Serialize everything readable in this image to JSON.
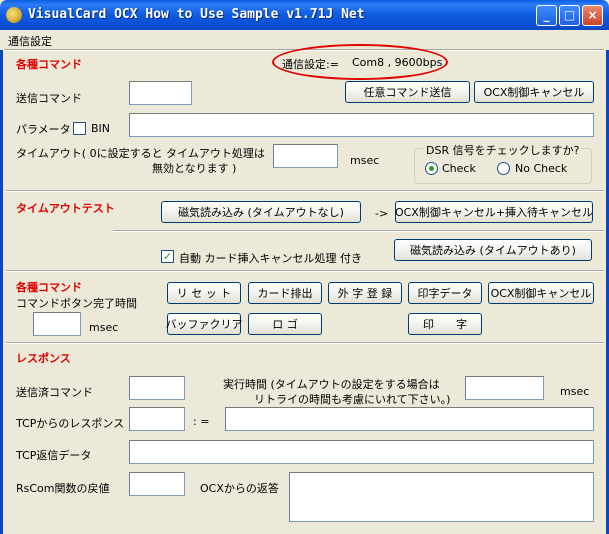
{
  "window": {
    "title": "VisualCard OCX How to Use Sample v1.71J Net",
    "minimize": "_",
    "maximize": "□",
    "close": "×"
  },
  "menu": {
    "item": "通信設定"
  },
  "commands": {
    "section_title": "各種コマンド",
    "comm_setting_label": "通信設定:=",
    "comm_setting_value": "Com8 , 9600bps",
    "send_command_label": "送信コマンド",
    "any_command_button": "任意コマンド送信",
    "ocx_cancel_button": "OCX制御キャンセル",
    "parameter_label": "パラメータ",
    "bin_label": "BIN",
    "timeout_label_1": "タイムアウト( 0に設定すると タイムアウト処理は",
    "timeout_label_2": "無効となります )",
    "msec": "msec",
    "dsr_title": "DSR 信号をチェックしますか?",
    "dsr_check": "Check",
    "dsr_nocheck": "No Check",
    "dsr_selected": "Check"
  },
  "timeout_test": {
    "section_title": "タイムアウトテスト",
    "mag_read_no_timeout": "磁気読み込み (タイムアウトなし)",
    "arrow": "->",
    "ocx_cancel_insert_wait_cancel": "OCX制御キャンセル+挿入待キャンセル",
    "auto_cancel_label": "自動 カード挿入キャンセル処理 付き",
    "auto_cancel_checked": "✓",
    "mag_read_timeout": "磁気読み込み (タイムアウトあり)"
  },
  "various": {
    "section_title": "各種コマンド",
    "button_complete_time": "コマンドボタン完了時間",
    "msec": "msec",
    "reset": "リ セ ッ ト",
    "card_eject": "カード排出",
    "external_char_reg": "外 字 登 録",
    "print_data": "印字データ",
    "ocx_cancel": "OCX制御キャンセル",
    "buffer_clear": "バッファクリア",
    "logo": "ロ ゴ",
    "print": "印　　字"
  },
  "response": {
    "section_title": "レスポンス",
    "sent_command_label": "送信済コマンド",
    "exec_time_label_1": "実行時間 (タイムアウトの設定をする場合は",
    "exec_time_label_2": "リトライの時間も考慮にいれて下さい。)",
    "msec": "msec",
    "tcp_response_label": "TCPからのレスポンス",
    "colon_eq": ": =",
    "tcp_return_data_label": "TCP返信データ",
    "rscom_return_label": "RsCom関数の戻値",
    "ocx_return_label": "OCXからの返答"
  }
}
